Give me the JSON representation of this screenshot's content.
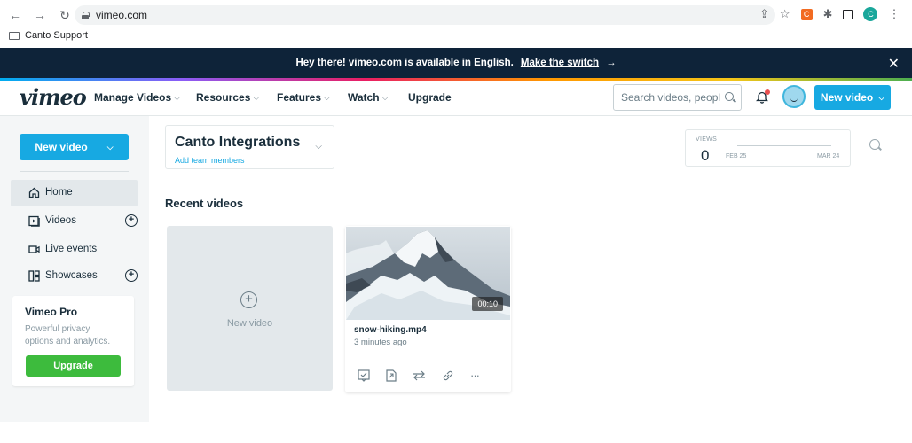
{
  "browser": {
    "url": "vimeo.com",
    "bookmark": "Canto Support",
    "profile_initial": "C"
  },
  "banner": {
    "text": "Hey there! vimeo.com is available in English.",
    "link": "Make the switch",
    "arrow": "→",
    "close": "✕"
  },
  "header": {
    "logo": "vimeo",
    "nav": [
      "Manage Videos",
      "Resources",
      "Features",
      "Watch",
      "Upgrade"
    ],
    "search_placeholder": "Search videos, peopl",
    "new_video": "New video"
  },
  "sidebar": {
    "new_video": "New video",
    "items": [
      {
        "label": "Home",
        "icon": "home-icon"
      },
      {
        "label": "Videos",
        "icon": "video-library-icon"
      },
      {
        "label": "Live events",
        "icon": "camera-icon"
      },
      {
        "label": "Showcases",
        "icon": "showcase-icon"
      }
    ],
    "pro": {
      "title": "Vimeo Pro",
      "desc": "Powerful privacy options and analytics.",
      "button": "Upgrade"
    }
  },
  "team": {
    "name": "Canto Integrations",
    "add_link": "Add team members"
  },
  "views": {
    "label": "VIEWS",
    "count": "0",
    "start": "FEB 25",
    "end": "MAR 24"
  },
  "main": {
    "recent_title": "Recent videos",
    "new_card_label": "New video",
    "video": {
      "name": "snow-hiking.mp4",
      "time": "3 minutes ago",
      "duration": "00:10"
    },
    "more": "···"
  },
  "colors": {
    "accent": "#17a9e2",
    "banner_bg": "#0e2339",
    "upgrade_green": "#3dbb3d"
  }
}
